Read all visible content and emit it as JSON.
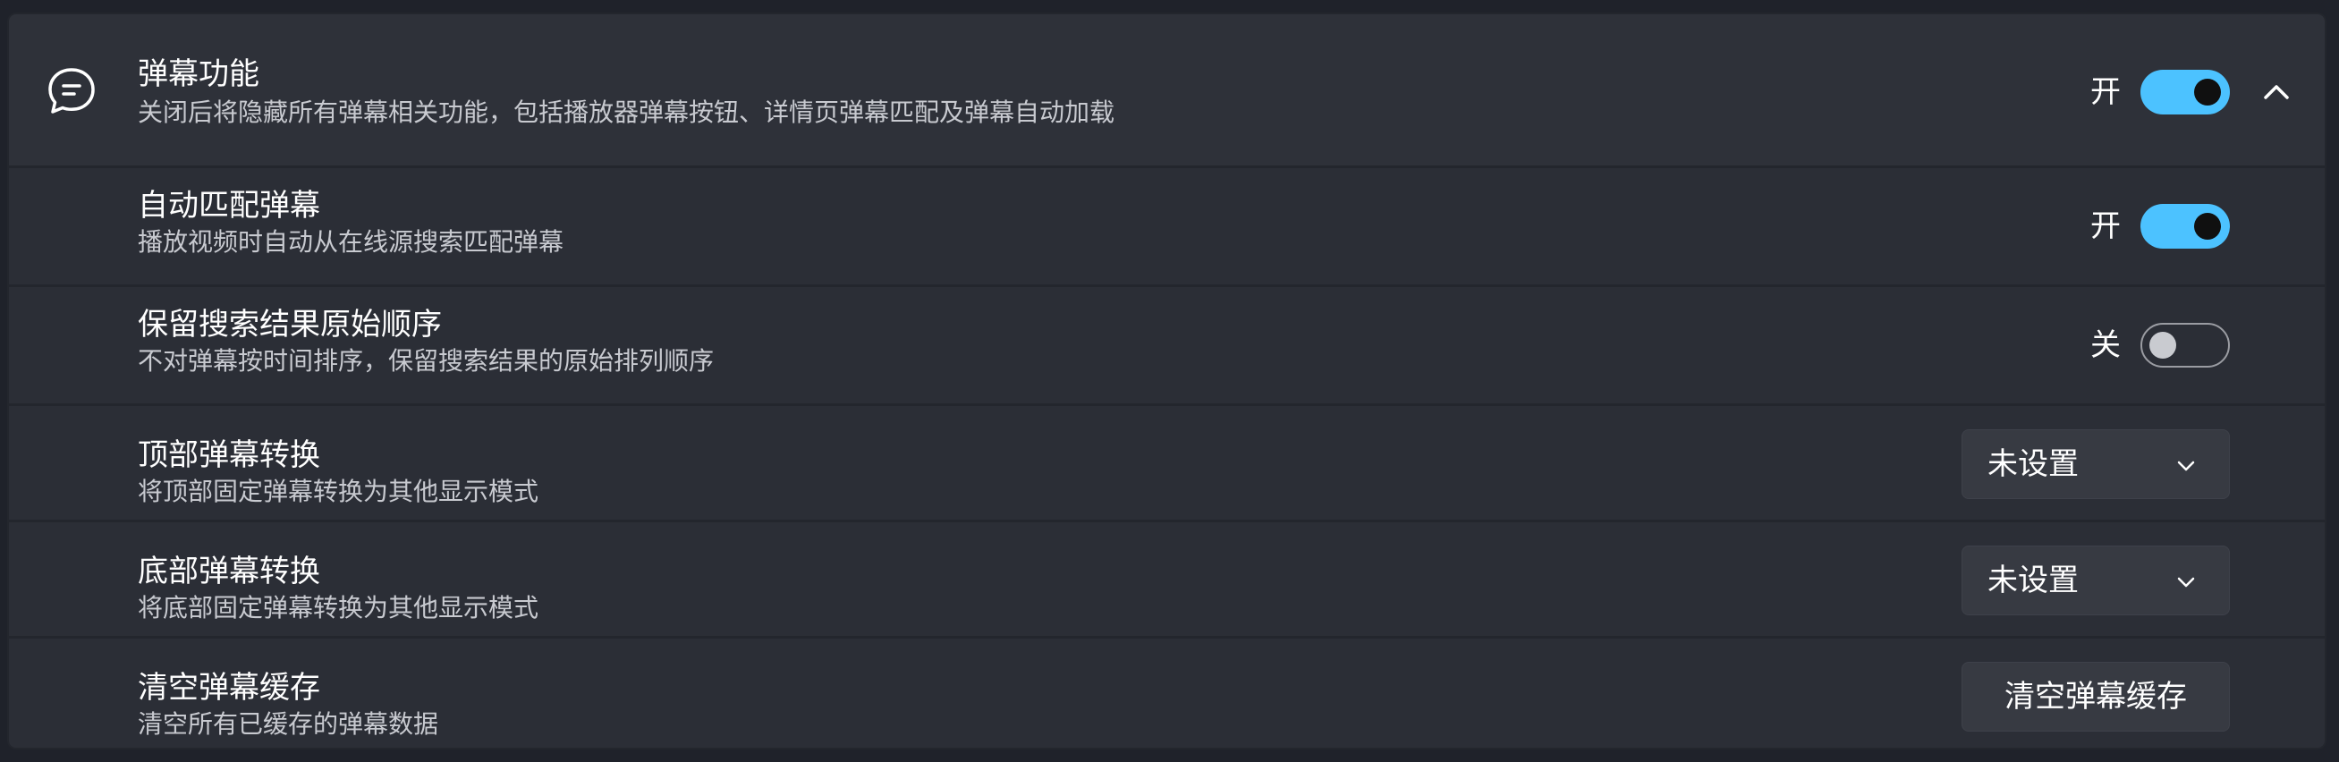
{
  "danmaku": {
    "icon": "chat-bubble-icon",
    "title": "弹幕功能",
    "description": "关闭后将隐藏所有弹幕相关功能，包括播放器弹幕按钮、详情页弹幕匹配及弹幕自动加载",
    "state_label": "开",
    "enabled": true,
    "expanded": true
  },
  "settings": [
    {
      "title": "自动匹配弹幕",
      "description": "播放视频时自动从在线源搜索匹配弹幕",
      "control": "toggle",
      "state_label": "开",
      "enabled": true
    },
    {
      "title": "保留搜索结果原始顺序",
      "description": "不对弹幕按时间排序，保留搜索结果的原始排列顺序",
      "control": "toggle",
      "state_label": "关",
      "enabled": false
    },
    {
      "title": "顶部弹幕转换",
      "description": "将顶部固定弹幕转换为其他显示模式",
      "control": "dropdown",
      "selected": "未设置"
    },
    {
      "title": "底部弹幕转换",
      "description": "将底部固定弹幕转换为其他显示模式",
      "control": "dropdown",
      "selected": "未设置"
    },
    {
      "title": "清空弹幕缓存",
      "description": "清空所有已缓存的弹幕数据",
      "control": "button",
      "button_label": "清空弹幕缓存"
    }
  ],
  "colors": {
    "accent": "#4cc2ff",
    "background": "#2b2e36"
  }
}
